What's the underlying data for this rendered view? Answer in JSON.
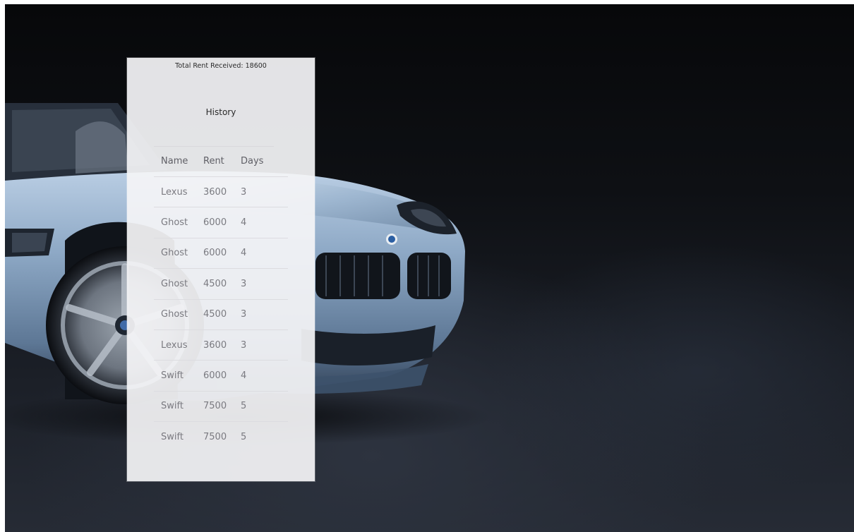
{
  "summary": {
    "total_rent_text": "Total Rent Received: 18600"
  },
  "history": {
    "title": "History",
    "columns": [
      "Name",
      "Rent",
      "Days"
    ],
    "rows": [
      {
        "name": "Lexus",
        "rent": "3600",
        "days": "3"
      },
      {
        "name": "Ghost",
        "rent": "6000",
        "days": "4"
      },
      {
        "name": "Ghost",
        "rent": "6000",
        "days": "4"
      },
      {
        "name": "Ghost",
        "rent": "4500",
        "days": "3"
      },
      {
        "name": "Ghost",
        "rent": "4500",
        "days": "3"
      },
      {
        "name": "Lexus",
        "rent": "3600",
        "days": "3"
      },
      {
        "name": "Swift",
        "rent": "6000",
        "days": "4"
      },
      {
        "name": "Swift",
        "rent": "7500",
        "days": "5"
      },
      {
        "name": "Swift",
        "rent": "7500",
        "days": "5"
      }
    ]
  },
  "background": {
    "image": "blue-convertible-car-photo",
    "colors": {
      "backdrop_dark": "#0e1014",
      "car_body": "#8ea9c6",
      "panel": "#f4f4f6"
    }
  }
}
